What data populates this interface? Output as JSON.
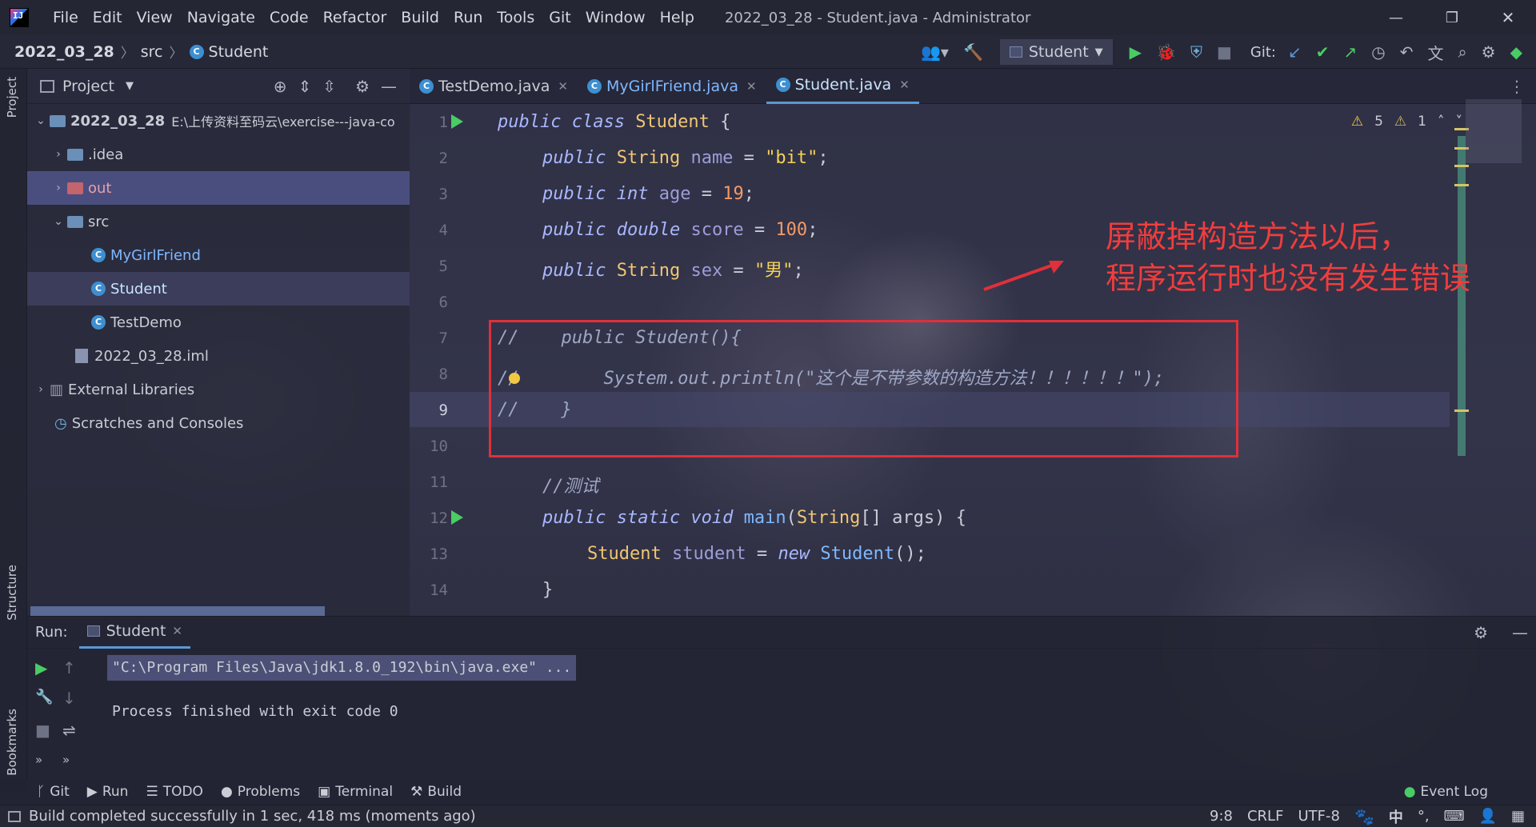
{
  "window": {
    "title": "2022_03_28 - Student.java - Administrator"
  },
  "menu": [
    "File",
    "Edit",
    "View",
    "Navigate",
    "Code",
    "Refactor",
    "Build",
    "Run",
    "Tools",
    "Git",
    "Window",
    "Help"
  ],
  "breadcrumb": {
    "project": "2022_03_28",
    "folder": "src",
    "file": "Student"
  },
  "toolbar": {
    "run_config": "Student",
    "git_label": "Git:"
  },
  "project_panel": {
    "title": "Project",
    "root": {
      "name": "2022_03_28",
      "path": "E:\\上传资料至码云\\exercise---java-co"
    },
    "items": [
      ".idea",
      "out",
      "src",
      "MyGirlFriend",
      "Student",
      "TestDemo",
      "2022_03_28.iml",
      "External Libraries",
      "Scratches and Consoles"
    ]
  },
  "left_strip": {
    "project": "Project",
    "structure": "Structure",
    "bookmarks": "Bookmarks"
  },
  "tabs": [
    {
      "label": "TestDemo.java"
    },
    {
      "label": "MyGirlFriend.java"
    },
    {
      "label": "Student.java"
    }
  ],
  "editor": {
    "warnings": "5",
    "weak_warnings": "1",
    "line_numbers": [
      "1",
      "2",
      "3",
      "4",
      "5",
      "6",
      "7",
      "8",
      "9",
      "10",
      "11",
      "12",
      "13",
      "14"
    ],
    "lines": {
      "l1a": "public class ",
      "l1b": "Student",
      "l1c": " {",
      "l2a": "public ",
      "l2b": "String",
      "l2c": " name",
      "l2d": " = ",
      "l2e": "\"bit\"",
      "l2f": ";",
      "l3a": "public ",
      "l3b": "int",
      "l3c": " age",
      "l3d": " = ",
      "l3e": "19",
      "l3f": ";",
      "l4a": "public ",
      "l4b": "double",
      "l4c": " score",
      "l4d": " = ",
      "l4e": "100",
      "l4f": ";",
      "l5a": "public ",
      "l5b": "String",
      "l5c": " sex",
      "l5d": " = ",
      "l5e": "\"男\"",
      "l5f": ";",
      "l7": "//    public Student(){",
      "l8": "//        System.out.println(\"这个是不带参数的构造方法！！！！！！\");",
      "l9": "//    }",
      "l11": "//测试",
      "l12a": "public static void ",
      "l12b": "main",
      "l12c": "(",
      "l12d": "String",
      "l12e": "[] args) {",
      "l13a": "Student",
      "l13b": " student",
      "l13c": " = ",
      "l13d": "new ",
      "l13e": "Student",
      "l13f": "();",
      "l14": "}"
    }
  },
  "annotation": {
    "line1": "屏蔽掉构造方法以后，",
    "line2": "程序运行时也没有发生错误"
  },
  "run_panel": {
    "label": "Run:",
    "tab": "Student",
    "command": "\"C:\\Program Files\\Java\\jdk1.8.0_192\\bin\\java.exe\" ...",
    "result": "Process finished with exit code 0"
  },
  "tool_windows": [
    "Git",
    "Run",
    "TODO",
    "Problems",
    "Terminal",
    "Build"
  ],
  "event_log": "Event Log",
  "status": {
    "message": "Build completed successfully in 1 sec, 418 ms (moments ago)",
    "position": "9:8",
    "line_sep": "CRLF",
    "encoding": "UTF-8",
    "ime": "中"
  },
  "colors": {
    "accent": "#5d97d4",
    "run_green": "#49cc64",
    "annotation_red": "#e0303a"
  }
}
